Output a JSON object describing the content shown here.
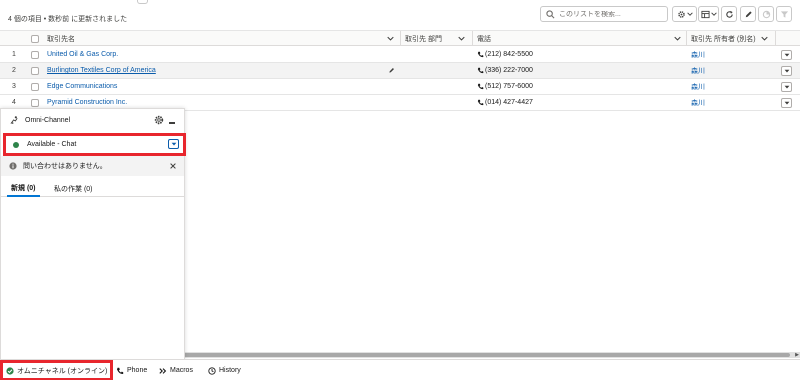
{
  "list": {
    "meta": "4 個の項目 • 数秒前 に更新されました",
    "search_placeholder": "このリストを検索..."
  },
  "table": {
    "columns": [
      "取引先名",
      "取引先 部門",
      "電話",
      "取引先 所有者 (別名)"
    ],
    "rows": [
      {
        "num": "1",
        "name": "United Oil & Gas Corp.",
        "phone": "(212) 842-5500",
        "owner": "森川"
      },
      {
        "num": "2",
        "name": "Burlington Textiles Corp of America",
        "phone": "(336) 222-7000",
        "owner": "森川"
      },
      {
        "num": "3",
        "name": "Edge Communications",
        "phone": "(512) 757-6000",
        "owner": "森川"
      },
      {
        "num": "4",
        "name": "Pyramid Construction Inc.",
        "phone": "(014) 427-4427",
        "owner": "森川"
      }
    ]
  },
  "omni": {
    "title": "Omni-Channel",
    "status": "Available - Chat",
    "notice": "問い合わせはありません。",
    "tabs": [
      {
        "label": "新規 (0)"
      },
      {
        "label": "私の作業 (0)"
      }
    ]
  },
  "footer": {
    "items": [
      {
        "label": "オムニチャネル (オンライン)"
      },
      {
        "label": "Phone"
      },
      {
        "label": "Macros"
      },
      {
        "label": "History"
      }
    ]
  },
  "colors": {
    "link": "#0b5cab",
    "highlight": "#e8262d",
    "online": "#2e844a"
  }
}
